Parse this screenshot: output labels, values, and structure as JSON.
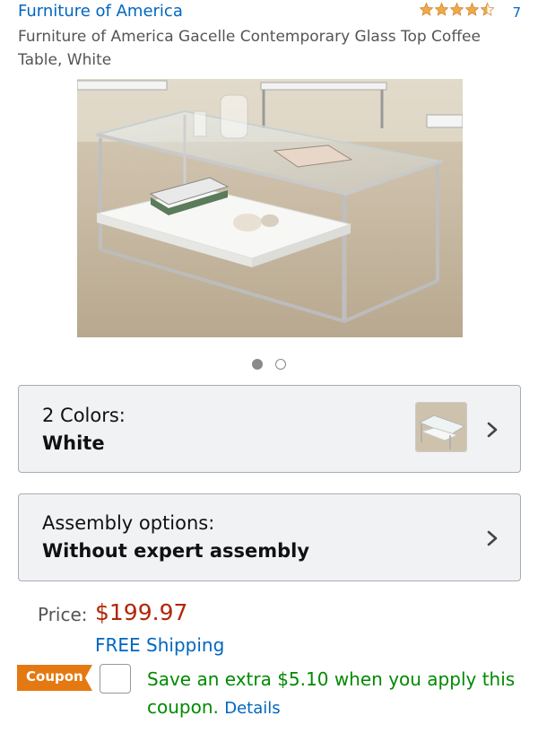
{
  "product": {
    "brand": "Furniture of America",
    "rating": 4.5,
    "review_count": "7",
    "title": "Furniture of America Gacelle Contemporary Glass Top Coffee Table, White"
  },
  "gallery": {
    "image_count": 2,
    "active_index": 0
  },
  "color_option": {
    "label": "2 Colors:",
    "value": "White"
  },
  "assembly_option": {
    "label": "Assembly options:",
    "value": "Without expert assembly"
  },
  "pricing": {
    "price_label": "Price:",
    "price": "$199.97",
    "shipping": "FREE Shipping"
  },
  "coupon": {
    "badge": "Coupon",
    "message": "Save an extra $5.10 when you apply this coupon.",
    "details_link": "Details"
  },
  "colors": {
    "link": "#0066c0",
    "price": "#b12704",
    "coupon_green": "#008a00",
    "coupon_badge": "#e47911",
    "star": "#f3a847"
  },
  "icons": {
    "chevron": "chevron-right-icon",
    "star": "star-icon"
  }
}
